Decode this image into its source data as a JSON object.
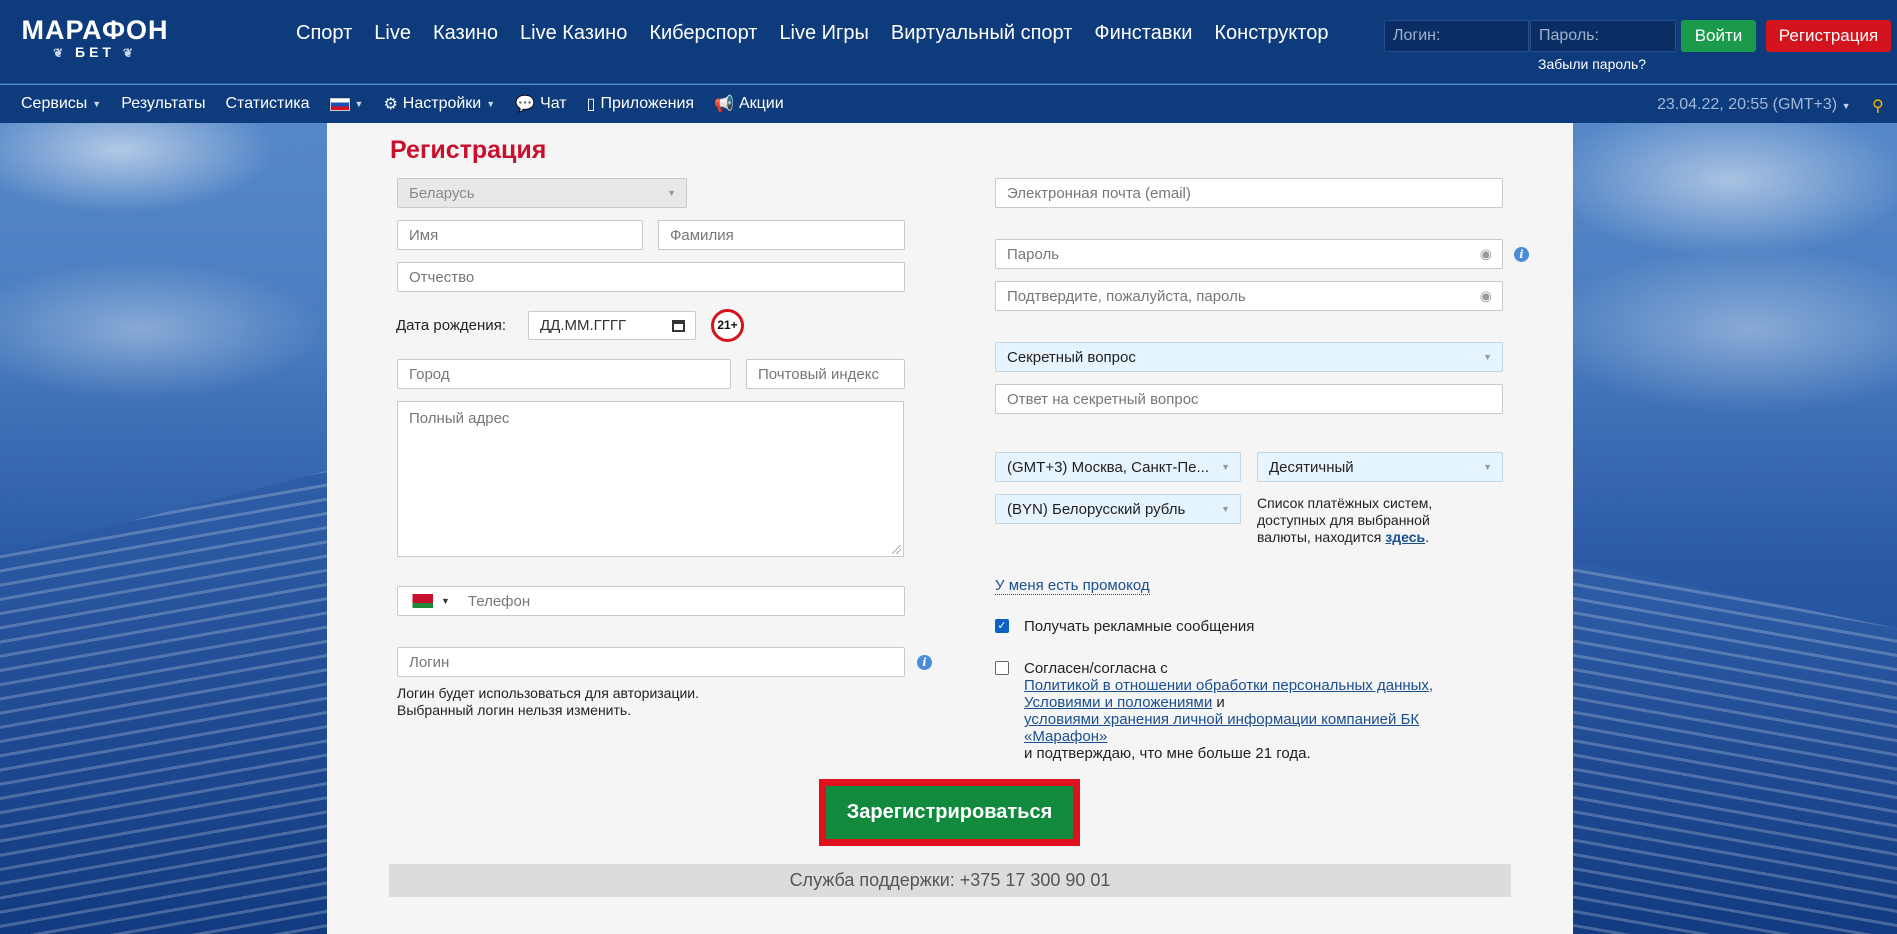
{
  "header": {
    "logo_top": "МАРАФОН",
    "logo_bottom": "БЕТ",
    "nav": [
      "Спорт",
      "Live",
      "Казино",
      "Live Казино",
      "Киберспорт",
      "Live Игры",
      "Виртуальный спорт",
      "Финставки",
      "Конструктор"
    ],
    "login_placeholder": "Логин:",
    "password_placeholder": "Пароль:",
    "login_button": "Войти",
    "register_button": "Регистрация",
    "forgot_password": "Забыли пароль?"
  },
  "subnav": {
    "services": "Сервисы",
    "results": "Результаты",
    "statistics": "Статистика",
    "settings": "Настройки",
    "chat": "Чат",
    "apps": "Приложения",
    "promos": "Акции",
    "datetime": "23.04.22, 20:55 (GMT+3)"
  },
  "form": {
    "title": "Регистрация",
    "country": "Беларусь",
    "first_name": "Имя",
    "last_name": "Фамилия",
    "patronymic": "Отчество",
    "dob_label": "Дата рождения:",
    "dob_placeholder": "ДД.ММ.ГГГГ",
    "age_badge": "21+",
    "city": "Город",
    "postcode": "Почтовый индекс",
    "address": "Полный адрес",
    "phone": "Телефон",
    "login": "Логин",
    "login_note_1": "Логин будет использоваться для авторизации.",
    "login_note_2": "Выбранный логин нельзя изменить.",
    "email": "Электронная почта (email)",
    "password": "Пароль",
    "password_confirm": "Подтвердите, пожалуйста, пароль",
    "secret_question": "Секретный вопрос",
    "secret_answer": "Ответ на секретный вопрос",
    "timezone": "(GMT+3) Москва, Санкт-Пе...",
    "odds_format": "Десятичный",
    "currency": "(BYN) Белорусский рубль",
    "payment_note_1": "Список платёжных систем,",
    "payment_note_2": "доступных для выбранной",
    "payment_note_3": "валюты, находится",
    "payment_link": "здесь",
    "promo_link": "У меня есть промокод",
    "ads_label": "Получать рекламные сообщения",
    "agree_label": "Согласен/согласна с",
    "policy_link": "Политикой в отношении обработки персональных данных,",
    "terms_link": "Условиями и положениями",
    "and": "и",
    "storage_link_1": "условиями хранения личной информации компанией БК",
    "storage_link_2": "«Марафон»",
    "confirm_age": "и подтверждаю, что мне больше 21 года.",
    "submit": "Зарегистрироваться",
    "support": "Служба поддержки: +375 17 300 90 01"
  }
}
